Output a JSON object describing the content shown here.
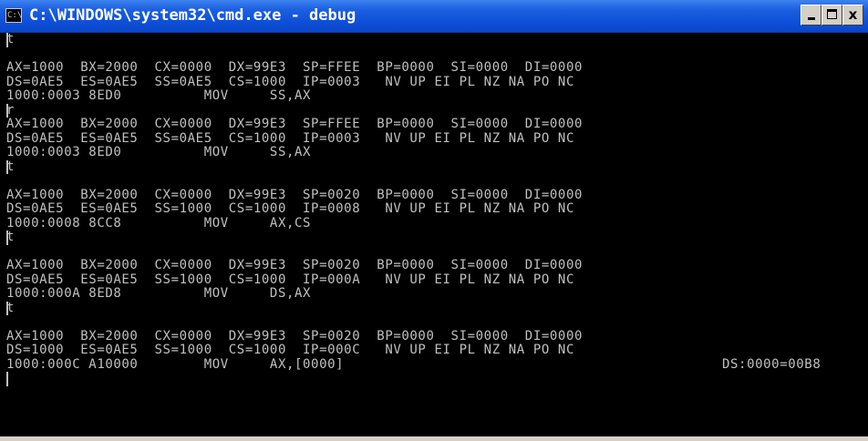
{
  "window": {
    "title": "C:\\WINDOWS\\system32\\cmd.exe - debug",
    "icon_text": "C:\\",
    "title_color": "#ffffff",
    "titlebar_color": "#0d4fd8",
    "text_color": "#c0c0c0",
    "background": "#000000"
  },
  "controls": {
    "minimize": "minimize-icon",
    "maximize": "maximize-icon",
    "close": "close-icon",
    "close_label": "x"
  },
  "console": {
    "lines": [
      "-t",
      "",
      "AX=1000  BX=2000  CX=0000  DX=99E3  SP=FFEE  BP=0000  SI=0000  DI=0000",
      "DS=0AE5  ES=0AE5  SS=0AE5  CS=1000  IP=0003   NV UP EI PL NZ NA PO NC",
      "1000:0003 8ED0          MOV     SS,AX",
      "-r",
      "AX=1000  BX=2000  CX=0000  DX=99E3  SP=FFEE  BP=0000  SI=0000  DI=0000",
      "DS=0AE5  ES=0AE5  SS=0AE5  CS=1000  IP=0003   NV UP EI PL NZ NA PO NC",
      "1000:0003 8ED0          MOV     SS,AX",
      "-t",
      "",
      "AX=1000  BX=2000  CX=0000  DX=99E3  SP=0020  BP=0000  SI=0000  DI=0000",
      "DS=0AE5  ES=0AE5  SS=1000  CS=1000  IP=0008   NV UP EI PL NZ NA PO NC",
      "1000:0008 8CC8          MOV     AX,CS",
      "-t",
      "",
      "AX=1000  BX=2000  CX=0000  DX=99E3  SP=0020  BP=0000  SI=0000  DI=0000",
      "DS=0AE5  ES=0AE5  SS=1000  CS=1000  IP=000A   NV UP EI PL NZ NA PO NC",
      "1000:000A 8ED8          MOV     DS,AX",
      "-t",
      "",
      "AX=1000  BX=2000  CX=0000  DX=99E3  SP=0020  BP=0000  SI=0000  DI=0000",
      "DS=1000  ES=0AE5  SS=1000  CS=1000  IP=000C   NV UP EI PL NZ NA PO NC",
      "1000:000C A10000        MOV     AX,[0000]",
      "-"
    ],
    "ds_value": "DS:0000=00B8"
  }
}
